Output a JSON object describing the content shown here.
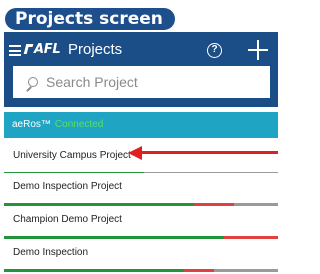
{
  "banner": {
    "text": "Projects screen"
  },
  "appbar": {
    "logo_text": "AFL",
    "title": "Projects"
  },
  "search": {
    "placeholder": "Search Project"
  },
  "status": {
    "device": "aeRos™",
    "state": "Connected"
  },
  "projects": [
    {
      "name": "University Campus Project"
    },
    {
      "name": "Demo Inspection Project"
    },
    {
      "name": "Champion Demo Project"
    },
    {
      "name": "Demo Inspection"
    }
  ],
  "colors": {
    "appbar": "#1b4d87",
    "status": "#20a4c4",
    "connected": "#59e05f",
    "progress_green": "#22943a",
    "progress_red": "#e04040",
    "progress_grey": "#9a9a9a",
    "arrow": "#e02020"
  },
  "icons": [
    "menu-icon",
    "afl-logo",
    "help-icon",
    "add-icon",
    "search-icon"
  ]
}
